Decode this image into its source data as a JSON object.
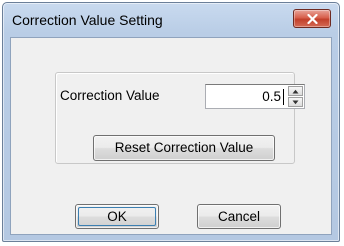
{
  "window": {
    "title": "Correction Value Setting"
  },
  "title_bar": {
    "close_icon": "close-x-icon"
  },
  "correction": {
    "label": "Correction Value",
    "value": "0.5",
    "spin_up_icon": "triangle-up-icon",
    "spin_down_icon": "triangle-down-icon"
  },
  "buttons": {
    "reset_label": "Reset Correction Value",
    "ok_label": "OK",
    "cancel_label": "Cancel"
  },
  "colors": {
    "title_bar": "#c3d5ec",
    "close_button": "#d4533f",
    "client_background": "#f0f0f0"
  }
}
